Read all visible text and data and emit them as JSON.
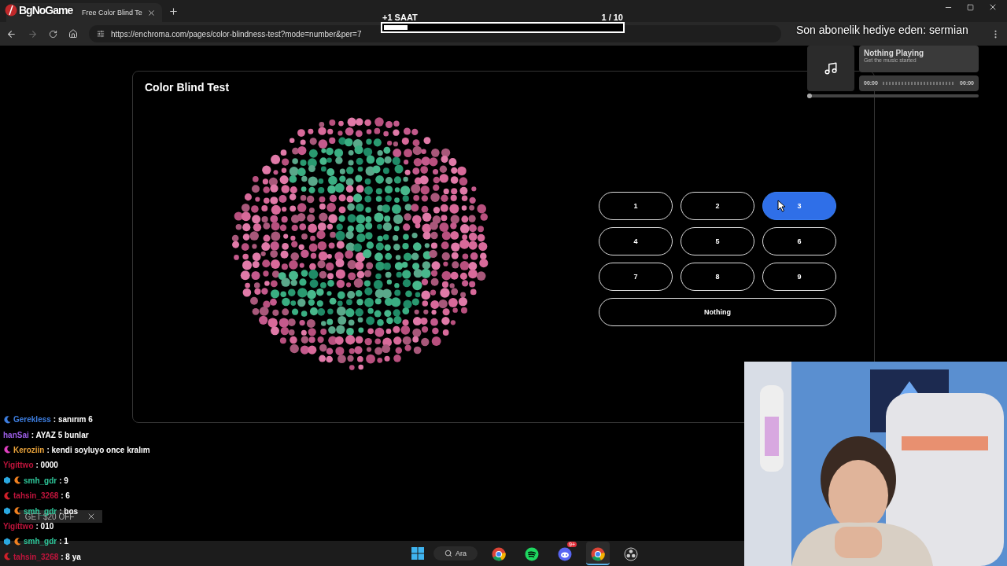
{
  "overlay": {
    "logo": "BgNoGame",
    "progress": {
      "label": "+1 SAAT",
      "level": 0.1,
      "count": "1  / 10"
    },
    "subscriber": "Son abonelik hediye eden: sermian"
  },
  "browser": {
    "tab": {
      "title": "Free Color Blind Te"
    },
    "url": "https://enchroma.com/pages/color-blindness-test?mode=number&per=7"
  },
  "test": {
    "title": "Color Blind Test",
    "options": [
      {
        "label": "1",
        "selected": false
      },
      {
        "label": "2",
        "selected": false
      },
      {
        "label": "3",
        "selected": true
      },
      {
        "label": "4",
        "selected": false
      },
      {
        "label": "5",
        "selected": false
      },
      {
        "label": "6",
        "selected": false
      },
      {
        "label": "7",
        "selected": false
      },
      {
        "label": "8",
        "selected": false
      },
      {
        "label": "9",
        "selected": false
      }
    ],
    "nothing": {
      "label": "Nothing",
      "selected": false
    }
  },
  "music": {
    "title": "Nothing Playing",
    "subtitle": "Get the music started",
    "elapsed": "00:00",
    "total": "00:00",
    "level": 0
  },
  "chat": [
    {
      "user": "Gerekless",
      "color": "#3d7ee0",
      "message": ": sanırım 6",
      "badges": [
        {
          "kind": "moon",
          "color": "#3d7ee0"
        }
      ]
    },
    {
      "user": "hanSai",
      "color": "#9b5de5",
      "message": ": AYAZ 5 bunlar"
    },
    {
      "user": "Keroziin",
      "color": "#e8a23a",
      "message": ": kendi soyluyo once kralım",
      "badges": [
        {
          "kind": "moon",
          "color": "#e040c0"
        }
      ]
    },
    {
      "user": "Yigittwo",
      "color": "#c0143c",
      "message": ": 0000"
    },
    {
      "user": "smh_gdr",
      "color": "#2ec79a",
      "message": ": 9",
      "badges": [
        {
          "kind": "cube",
          "color": "#2aa8e0"
        },
        {
          "kind": "moon",
          "color": "#f08020"
        }
      ]
    },
    {
      "user": "tahsin_3268",
      "color": "#c0143c",
      "message": ": 6",
      "badges": [
        {
          "kind": "moon",
          "color": "#d0202a"
        }
      ]
    },
    {
      "user": "smh_gdr",
      "color": "#2ec79a",
      "message": ": bos",
      "badges": [
        {
          "kind": "cube",
          "color": "#2aa8e0"
        },
        {
          "kind": "moon",
          "color": "#f08020"
        }
      ]
    },
    {
      "user": "Yigittwo",
      "color": "#c0143c",
      "message": ": 010"
    },
    {
      "user": "smh_gdr",
      "color": "#2ec79a",
      "message": ": 1",
      "badges": [
        {
          "kind": "cube",
          "color": "#2aa8e0"
        },
        {
          "kind": "moon",
          "color": "#f08020"
        }
      ]
    },
    {
      "user": "tahsin_3268",
      "color": "#c0143c",
      "message": ": 8 ya",
      "badges": [
        {
          "kind": "moon",
          "color": "#d0202a"
        }
      ]
    }
  ],
  "ad": {
    "label": "GET $20 OFF"
  },
  "taskbar": {
    "search": "Ara",
    "apps": [
      {
        "kind": "chrome",
        "active": false
      },
      {
        "kind": "spotify",
        "active": false
      },
      {
        "kind": "discord",
        "active": false,
        "badge": "9+"
      },
      {
        "kind": "chrome",
        "active": true
      },
      {
        "kind": "obs",
        "active": false
      }
    ]
  }
}
